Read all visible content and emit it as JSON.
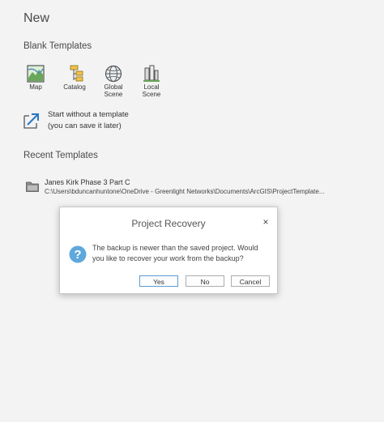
{
  "page": {
    "title": "New"
  },
  "blank_templates": {
    "title": "Blank Templates",
    "items": [
      {
        "label": "Map",
        "icon": "map-icon"
      },
      {
        "label": "Catalog",
        "icon": "catalog-icon"
      },
      {
        "label": "Global\nScene",
        "icon": "globe-icon"
      },
      {
        "label": "Local\nScene",
        "icon": "local-scene-icon"
      }
    ]
  },
  "start_without_template": {
    "line1": "Start without a template",
    "line2": "(you can save it later)",
    "icon": "arrow-out-icon"
  },
  "recent_templates": {
    "title": "Recent Templates",
    "items": [
      {
        "name": "Janes Kirk Phase 3 Part C",
        "path": "C:\\Users\\bduncanhuntone\\OneDrive - Greenlight Networks\\Documents\\ArcGIS\\ProjectTemplate...",
        "icon": "project-template-icon"
      }
    ]
  },
  "dialog": {
    "title": "Project Recovery",
    "close_label": "×",
    "message": "The backup is newer than the saved project. Would you like to recover your work from the backup?",
    "icon": "question-icon",
    "buttons": {
      "yes": "Yes",
      "no": "No",
      "cancel": "Cancel"
    }
  },
  "colors": {
    "background": "#f3f3f3",
    "accent": "#2a78c3",
    "question_icon": "#5fa8dc"
  }
}
